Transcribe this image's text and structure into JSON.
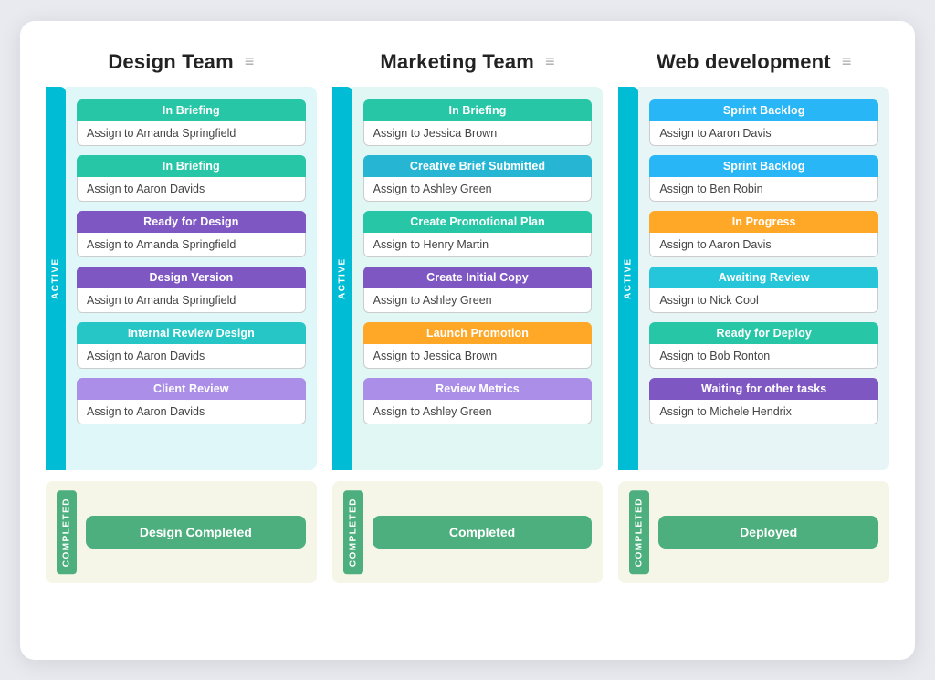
{
  "columns": [
    {
      "id": "design-team",
      "title": "Design Team",
      "bar_color": "active-bar-cyan",
      "active_label": "ACTIVE",
      "section_class": "active-section",
      "cards": [
        {
          "status": "In Briefing",
          "status_class": "status-in-briefing",
          "assign": "Assign to Amanda Springfield"
        },
        {
          "status": "In Briefing",
          "status_class": "status-in-briefing",
          "assign": "Assign to Aaron Davids"
        },
        {
          "status": "Ready for Design",
          "status_class": "status-ready-design",
          "assign": "Assign to Amanda Springfield"
        },
        {
          "status": "Design Version",
          "status_class": "status-design-version",
          "assign": "Assign to Amanda Springfield"
        },
        {
          "status": "Internal Review Design",
          "status_class": "status-internal-review",
          "assign": "Assign to Aaron Davids"
        },
        {
          "status": "Client Review",
          "status_class": "status-client-review",
          "assign": "Assign to Aaron Davids"
        }
      ],
      "completed_label": "COMPLETED",
      "completed_btn": "Design Completed"
    },
    {
      "id": "marketing-team",
      "title": "Marketing Team",
      "bar_color": "active-bar-cyan",
      "active_label": "ACTIVE",
      "section_class": "active-section active-section-marketing",
      "cards": [
        {
          "status": "In Briefing",
          "status_class": "status-in-briefing",
          "assign": "Assign to Jessica Brown"
        },
        {
          "status": "Creative Brief Submitted",
          "status_class": "status-creative-brief",
          "assign": "Assign to Ashley Green"
        },
        {
          "status": "Create Promotional Plan",
          "status_class": "status-create-promo",
          "assign": "Assign to Henry Martin"
        },
        {
          "status": "Create Initial Copy",
          "status_class": "status-create-copy",
          "assign": "Assign to Ashley Green"
        },
        {
          "status": "Launch Promotion",
          "status_class": "status-launch-promo",
          "assign": "Assign to Jessica Brown"
        },
        {
          "status": "Review Metrics",
          "status_class": "status-review-metrics",
          "assign": "Assign to Ashley Green"
        }
      ],
      "completed_label": "COMPLETED",
      "completed_btn": "Completed"
    },
    {
      "id": "web-development",
      "title": "Web development",
      "bar_color": "active-bar-cyan",
      "active_label": "ACTIVE",
      "section_class": "active-section active-section-web",
      "cards": [
        {
          "status": "Sprint Backlog",
          "status_class": "status-sprint-backlog",
          "assign": "Assign to Aaron Davis"
        },
        {
          "status": "Sprint Backlog",
          "status_class": "status-sprint-backlog",
          "assign": "Assign to Ben Robin"
        },
        {
          "status": "In Progress",
          "status_class": "status-in-progress",
          "assign": "Assign to Aaron Davis"
        },
        {
          "status": "Awaiting Review",
          "status_class": "status-awaiting-review",
          "assign": "Assign to Nick Cool"
        },
        {
          "status": "Ready for Deploy",
          "status_class": "status-ready-deploy",
          "assign": "Assign to Bob Ronton"
        },
        {
          "status": "Waiting for other tasks",
          "status_class": "status-waiting-other",
          "assign": "Assign to Michele Hendrix"
        }
      ],
      "completed_label": "COMPLETED",
      "completed_btn": "Deployed"
    }
  ],
  "menu_icon": "≡"
}
